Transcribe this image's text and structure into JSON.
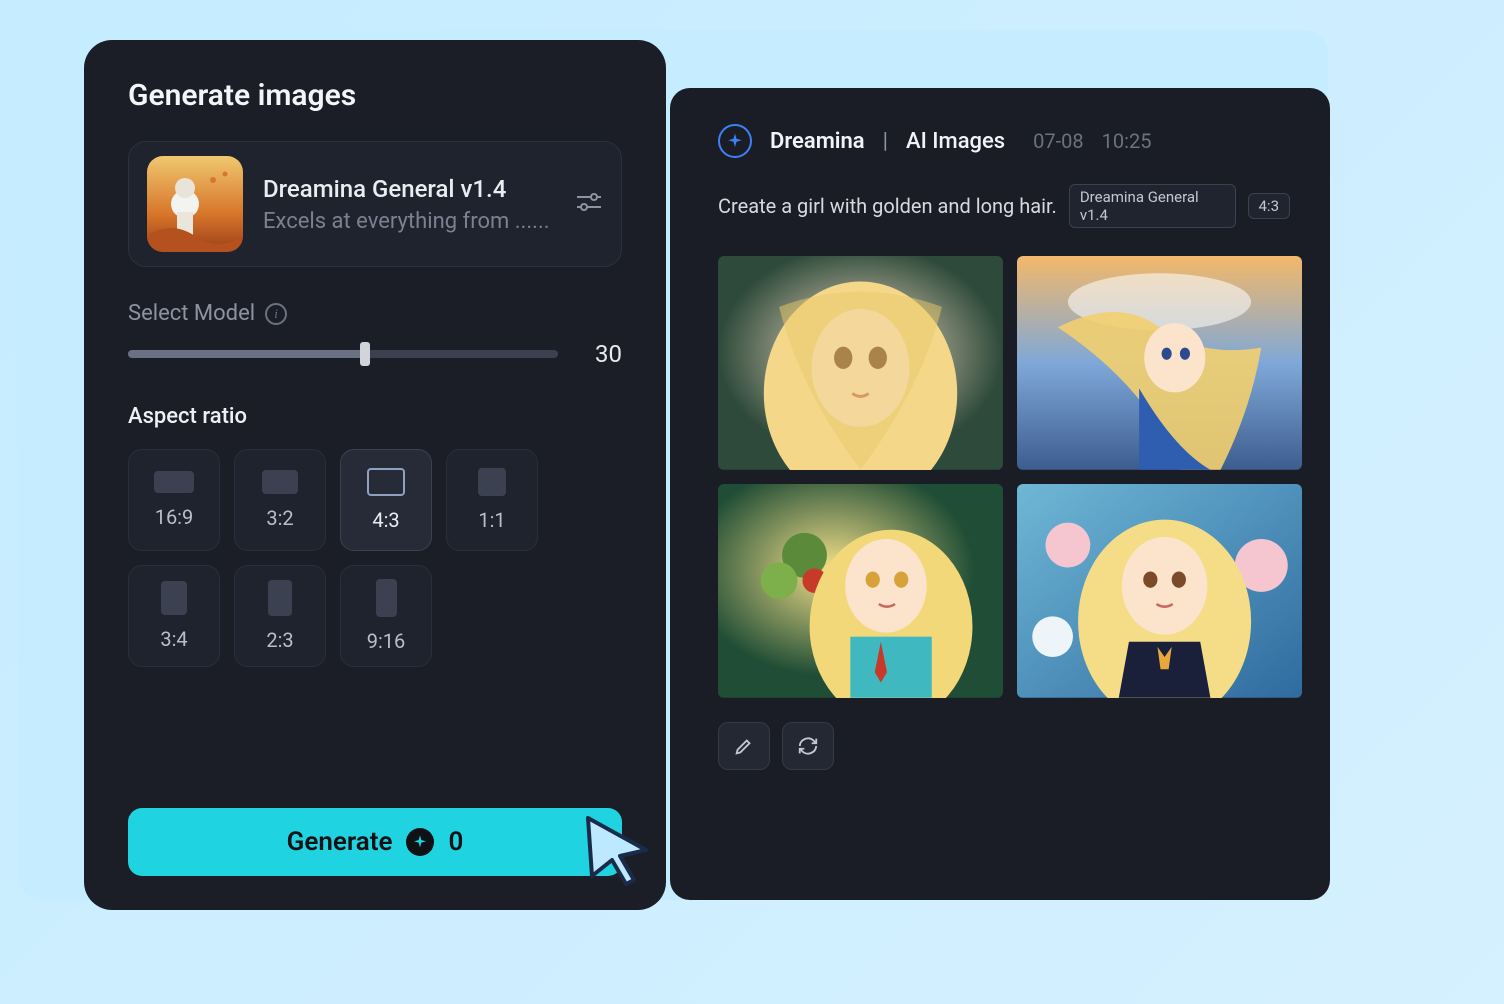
{
  "panel": {
    "title": "Generate images",
    "model": {
      "name": "Dreamina General v1.4",
      "desc": "Excels at everything from ......"
    },
    "select_model_label": "Select Model",
    "slider_value": "30",
    "aspect_label": "Aspect ratio",
    "ratios": [
      "16:9",
      "3:2",
      "4:3",
      "1:1",
      "3:4",
      "2:3",
      "9:16"
    ],
    "selected_ratio_index": 2,
    "generate_label": "Generate",
    "generate_count": "0"
  },
  "results": {
    "app": "Dreamina",
    "section": "AI Images",
    "date": "07-08",
    "time": "10:25",
    "prompt": "Create a girl with golden and long hair.",
    "tag_model": "Dreamina General v1.4",
    "tag_ratio": "4:3"
  }
}
